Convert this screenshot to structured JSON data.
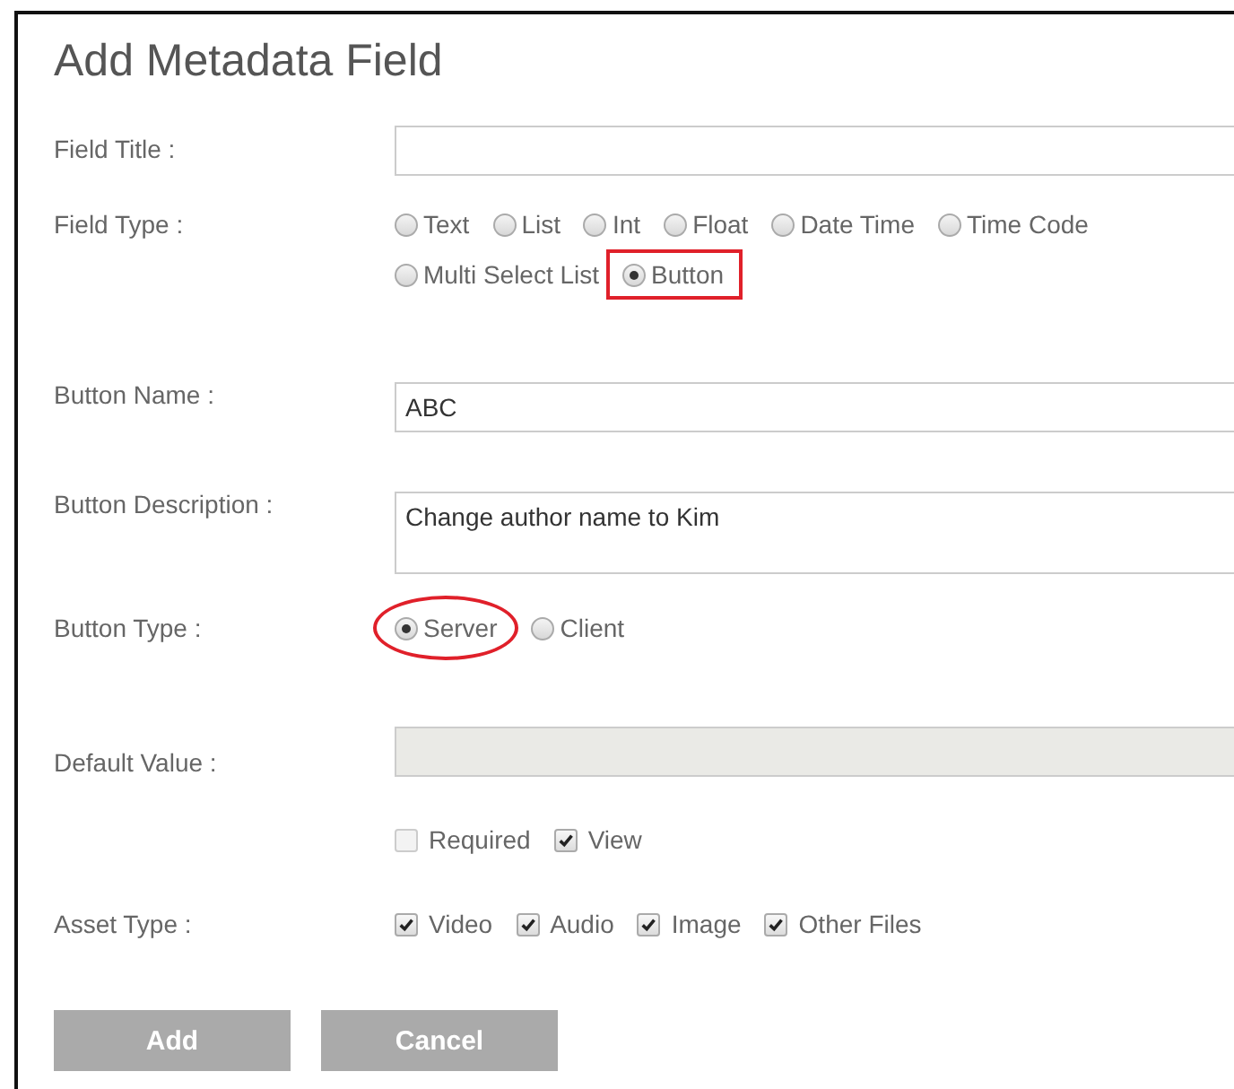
{
  "title": "Add Metadata Field",
  "field_title": {
    "label": "Field Title :"
  },
  "field_type": {
    "label": "Field Type :",
    "options": [
      {
        "label": "Text",
        "selected": false,
        "annotated": false
      },
      {
        "label": "List",
        "selected": false,
        "annotated": false
      },
      {
        "label": "Int",
        "selected": false,
        "annotated": false
      },
      {
        "label": "Float",
        "selected": false,
        "annotated": false
      },
      {
        "label": "Date Time",
        "selected": false,
        "annotated": false
      },
      {
        "label": "Time Code",
        "selected": false,
        "annotated": false
      },
      {
        "label": "Multi Select List",
        "selected": false,
        "annotated": false
      },
      {
        "label": "Button",
        "selected": true,
        "annotated": true
      }
    ]
  },
  "button_name": {
    "label": "Button Name :",
    "value": "ABC"
  },
  "button_description": {
    "label": "Button Description :",
    "value": "Change author name to Kim"
  },
  "button_type": {
    "label": "Button Type :",
    "options": [
      {
        "label": "Server",
        "selected": true,
        "annotated": true
      },
      {
        "label": "Client",
        "selected": false,
        "annotated": false
      }
    ]
  },
  "default_value": {
    "label": "Default Value :",
    "disabled": true
  },
  "flags": [
    {
      "label": "Required",
      "checked": false,
      "disabled": true
    },
    {
      "label": "View",
      "checked": true,
      "disabled": false
    }
  ],
  "asset_type": {
    "label": "Asset Type :",
    "options": [
      {
        "label": "Video",
        "checked": true
      },
      {
        "label": "Audio",
        "checked": true
      },
      {
        "label": "Image",
        "checked": true
      },
      {
        "label": "Other Files",
        "checked": true
      }
    ]
  },
  "buttons": [
    "Add",
    "Cancel"
  ]
}
